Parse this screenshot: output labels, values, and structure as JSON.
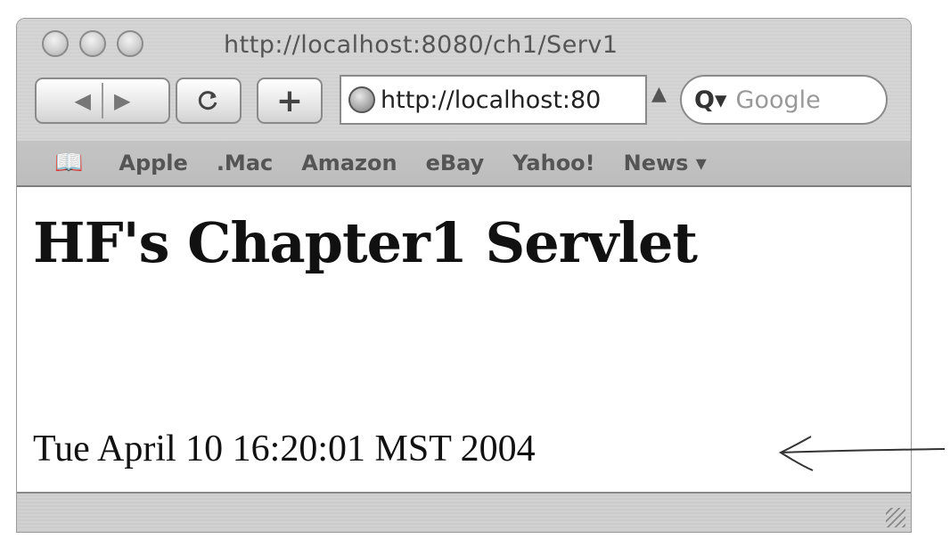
{
  "window": {
    "title": "http://localhost:8080/ch1/Serv1"
  },
  "toolbar": {
    "back_icon": "back-arrow-icon",
    "forward_icon": "forward-arrow-icon",
    "reload_icon": "reload-icon",
    "add_bookmark_label": "+",
    "address": "http://localhost:80",
    "search_placeholder": "Google"
  },
  "bookmarks": {
    "items": [
      "Apple",
      ".Mac",
      "Amazon",
      "eBay",
      "Yahoo!",
      "News ▾"
    ]
  },
  "content": {
    "heading": "HF's Chapter1 Servlet",
    "date_text": "Tue April 10 16:20:01 MST 2004"
  },
  "colors": {
    "chrome": "#d6d6d6",
    "page_bg": "#ffffff",
    "text": "#111111"
  }
}
